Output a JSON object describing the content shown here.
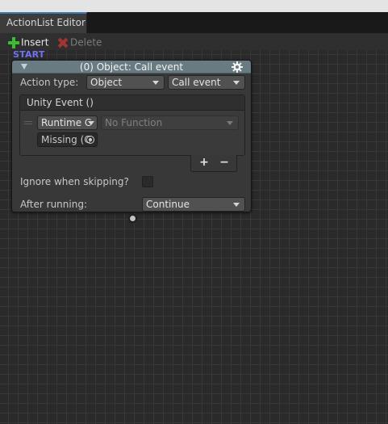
{
  "window": {
    "tab_title": "ActionList Editor"
  },
  "toolbar": {
    "insert_label": "Insert",
    "delete_label": "Delete"
  },
  "canvas": {
    "start_label": "START"
  },
  "node": {
    "title": "(0) Object: Call event",
    "action_type_label": "Action type:",
    "action_category": "Object",
    "action_name": "Call event",
    "unity_event": {
      "title": "Unity Event ()",
      "runtime_option": "Runtime C",
      "function_placeholder": "No Function",
      "object_field": "Missing (C",
      "add_label": "+",
      "remove_label": "−"
    },
    "ignore_label": "Ignore when skipping?",
    "ignore_checked": false,
    "after_running_label": "After running:",
    "after_running_value": "Continue"
  },
  "colors": {
    "start_label": "#6f73f0",
    "node_header": "#697b82",
    "insert_icon": "#3bbd32",
    "delete_icon": "#a33434",
    "tab_accent": "#3a79bb"
  },
  "icons": [
    "plus-icon",
    "delete-x-icon",
    "foldout-triangle-icon",
    "gear-icon",
    "dropdown-caret-icon",
    "object-picker-target-icon",
    "drag-handle-icon"
  ]
}
